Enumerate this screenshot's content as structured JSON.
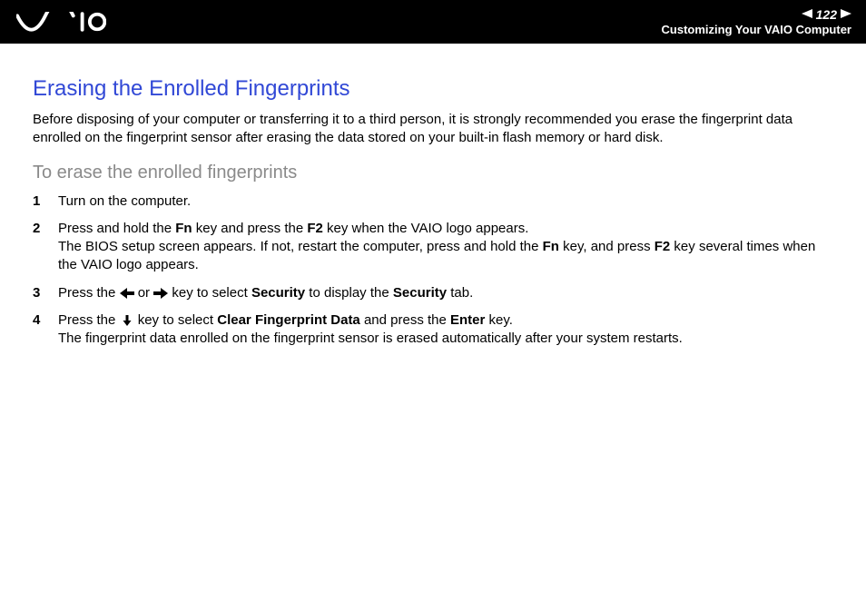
{
  "header": {
    "page_number": "122",
    "section": "Customizing Your VAIO Computer"
  },
  "title": "Erasing the Enrolled Fingerprints",
  "intro": "Before disposing of your computer or transferring it to a third person, it is strongly recommended you erase the fingerprint data enrolled on the fingerprint sensor after erasing the data stored on your built-in flash memory or hard disk.",
  "subhead": "To erase the enrolled fingerprints",
  "steps": {
    "s1": "Turn on the computer.",
    "s2_a": "Press and hold the ",
    "s2_fn": "Fn",
    "s2_b": " key and press the ",
    "s2_f2": "F2",
    "s2_c": " key when the VAIO logo appears.",
    "s2_d": "The BIOS setup screen appears. If not, restart the computer, press and hold the ",
    "s2_fn2": "Fn",
    "s2_e": " key, and press ",
    "s2_f22": "F2",
    "s2_f": " key several times when the VAIO logo appears.",
    "s3_a": "Press the ",
    "s3_b": " or ",
    "s3_c": " key to select ",
    "s3_sec": "Security",
    "s3_d": " to display the ",
    "s3_sec2": "Security",
    "s3_e": " tab.",
    "s4_a": "Press the ",
    "s4_b": " key to select ",
    "s4_cfd": "Clear Fingerprint Data",
    "s4_c": " and press the ",
    "s4_enter": "Enter",
    "s4_d": " key.",
    "s4_e": "The fingerprint data enrolled on the fingerprint sensor is erased automatically after your system restarts."
  }
}
